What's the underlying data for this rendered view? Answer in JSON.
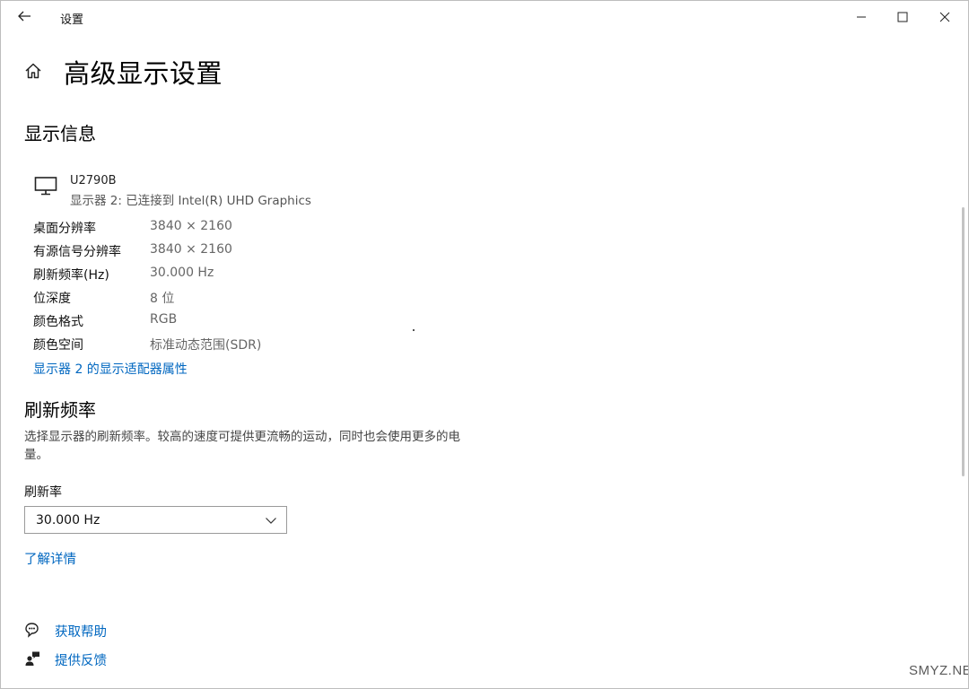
{
  "window": {
    "title": "设置",
    "controls": {
      "minimize": "minimize",
      "maximize": "maximize",
      "close": "close"
    }
  },
  "page": {
    "title": "高级显示设置"
  },
  "display_info": {
    "section_title": "显示信息",
    "monitor": {
      "name": "U2790B",
      "subtitle": "显示器 2: 已连接到 Intel(R) UHD Graphics",
      "icon": "monitor-icon"
    },
    "rows": [
      {
        "label": "桌面分辨率",
        "value": "3840 × 2160"
      },
      {
        "label": "有源信号分辨率",
        "value": "3840 × 2160"
      },
      {
        "label": "刷新频率(Hz)",
        "value": "30.000 Hz"
      },
      {
        "label": "位深度",
        "value": "8 位"
      },
      {
        "label": "颜色格式",
        "value": "RGB"
      },
      {
        "label": "颜色空间",
        "value": "标准动态范围(SDR)"
      }
    ],
    "adapter_link": "显示器 2 的显示适配器属性"
  },
  "refresh": {
    "section_title": "刷新频率",
    "description": "选择显示器的刷新频率。较高的速度可提供更流畅的运动，同时也会使用更多的电量。",
    "field_label": "刷新率",
    "selected": "30.000 Hz",
    "learn_more": "了解详情"
  },
  "help": {
    "get_help": "获取帮助",
    "feedback": "提供反馈"
  },
  "watermark": "SMYZ.NET",
  "colors": {
    "link": "#0067c0",
    "text": "#000000",
    "muted": "#666666"
  }
}
